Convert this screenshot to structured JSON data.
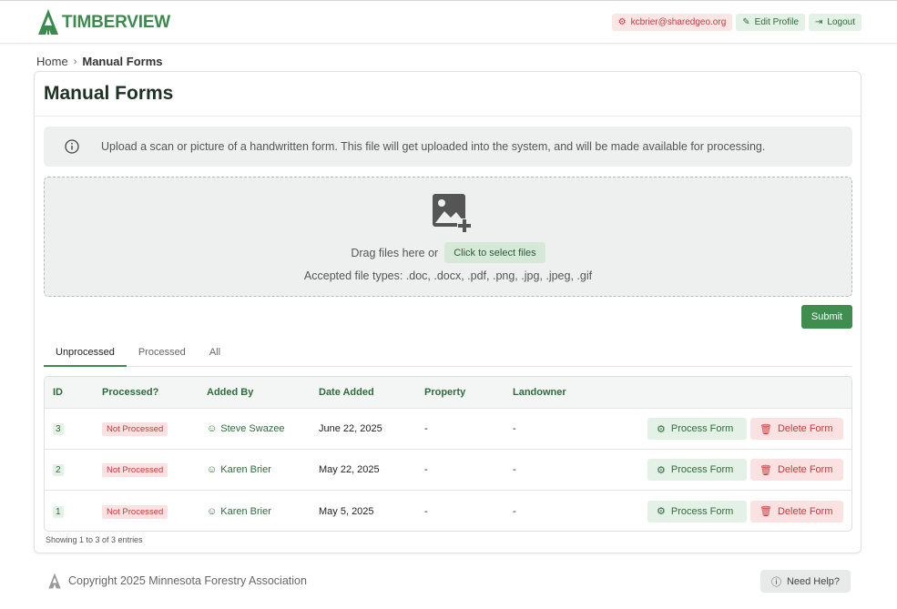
{
  "brand": {
    "name": "TIMBERVIEW",
    "icon": "tree-icon",
    "color": "#3d8a4e"
  },
  "header": {
    "user_email": "kcbrier@sharedgeo.org",
    "edit_profile": "Edit Profile",
    "logout": "Logout"
  },
  "breadcrumb": {
    "home": "Home",
    "current": "Manual Forms"
  },
  "page": {
    "title": "Manual Forms"
  },
  "alert": {
    "text": "Upload a scan or picture of a handwritten form. This file will get uploaded into the system, and will be made available for processing.",
    "icon": "info-icon"
  },
  "dropzone": {
    "drag_text": "Drag files here or",
    "select_label": "Click to select files",
    "accepted": "Accepted file types: .doc, .docx, .pdf, .png, .jpg, .jpeg, .gif",
    "icon": "image-add-icon"
  },
  "submit_label": "Submit",
  "tabs": [
    {
      "label": "Unprocessed",
      "active": true
    },
    {
      "label": "Processed",
      "active": false
    },
    {
      "label": "All",
      "active": false
    }
  ],
  "table": {
    "columns": [
      "ID",
      "Processed?",
      "Added By",
      "Date Added",
      "Property",
      "Landowner"
    ],
    "rows": [
      {
        "id": "3",
        "status": "Not Processed",
        "added_by": "Steve Swazee",
        "date": "June 22, 2025",
        "property": "-",
        "landowner": "-"
      },
      {
        "id": "2",
        "status": "Not Processed",
        "added_by": "Karen Brier",
        "date": "May 22, 2025",
        "property": "-",
        "landowner": "-"
      },
      {
        "id": "1",
        "status": "Not Processed",
        "added_by": "Karen Brier",
        "date": "May 5, 2025",
        "property": "-",
        "landowner": "-"
      }
    ],
    "process_label": "Process Form",
    "delete_label": "Delete Form",
    "showing": "Showing 1 to 3 of 3 entries"
  },
  "footer": {
    "copyright": "Copyright 2025 Minnesota Forestry Association",
    "help": "Need Help?"
  },
  "colors": {
    "accent_green": "#3f8e4f",
    "danger": "#c53a3a"
  }
}
